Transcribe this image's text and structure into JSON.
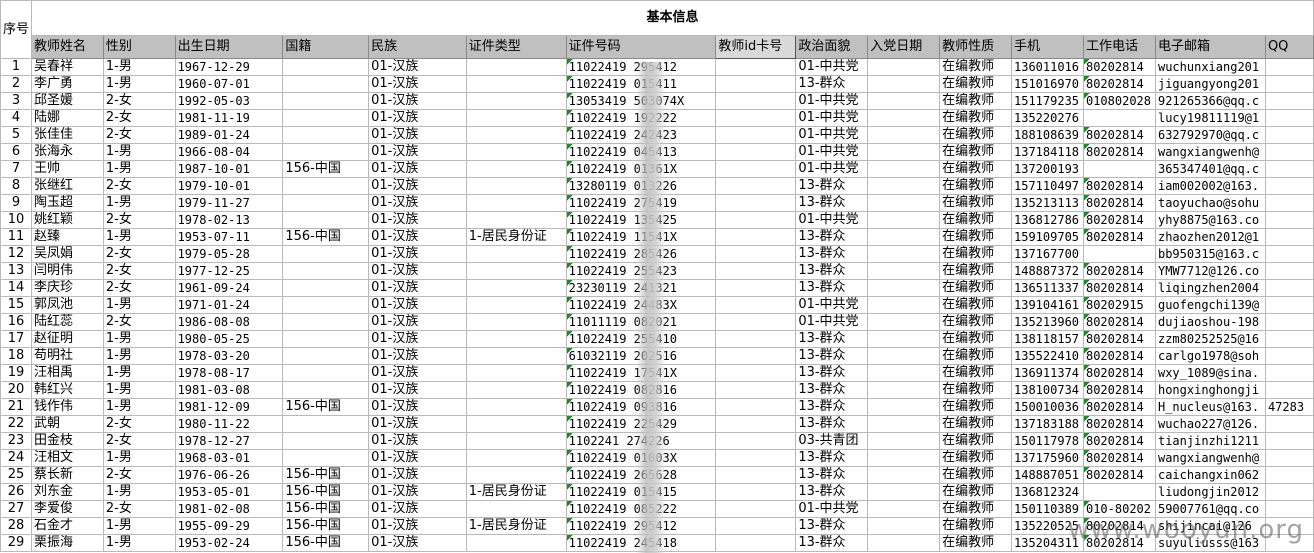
{
  "title": "基本信息",
  "seq_header": "序号",
  "columns": [
    "教师姓名",
    "性别",
    "出生日期",
    "国籍",
    "民族",
    "证件类型",
    "证件号码",
    "教师id卡号",
    "政治面貌",
    "入党日期",
    "教师性质",
    "手机",
    "工作电话",
    "电子邮箱",
    "QQ"
  ],
  "rows": [
    [
      "1",
      "吴春祥",
      "1-男",
      "1967-12-29",
      "",
      "01-汉族",
      "",
      "11022419    295412",
      "",
      "01-中共党",
      "",
      "在编教师",
      "136011016",
      "80202814",
      "wuchunxiang201",
      ""
    ],
    [
      "2",
      "李广勇",
      "1-男",
      "1960-07-01",
      "",
      "01-汉族",
      "",
      "11022419    015411",
      "",
      "13-群众",
      "",
      "在编教师",
      "151016970",
      "80202814",
      "jiguangyong201",
      ""
    ],
    [
      "3",
      "邱圣媛",
      "2-女",
      "1992-05-03",
      "",
      "01-汉族",
      "",
      "13053419    503074X",
      "",
      "01-中共党",
      "",
      "在编教师",
      "151179235",
      "010802028",
      "921265366@qq.c",
      ""
    ],
    [
      "4",
      "陆娜",
      "2-女",
      "1981-11-19",
      "",
      "01-汉族",
      "",
      "11022419    192222",
      "",
      "01-中共党",
      "",
      "在编教师",
      "135220276",
      "",
      "lucy19811119@1",
      ""
    ],
    [
      "5",
      "张佳佳",
      "2-女",
      "1989-01-24",
      "",
      "01-汉族",
      "",
      "11022419    242423",
      "",
      "01-中共党",
      "",
      "在编教师",
      "188108639",
      "80202814",
      "632792970@qq.c",
      ""
    ],
    [
      "6",
      "张海永",
      "1-男",
      "1966-08-04",
      "",
      "01-汉族",
      "",
      "11022419    045413",
      "",
      "01-中共党",
      "",
      "在编教师",
      "137184118",
      "80202814",
      "wangxiangwenh@",
      ""
    ],
    [
      "7",
      "王帅",
      "1-男",
      "1987-10-01",
      "156-中国",
      "01-汉族",
      "",
      "11022419    01361X",
      "",
      "01-中共党",
      "",
      "在编教师",
      "137200193",
      "",
      "365347401@qq.c",
      ""
    ],
    [
      "8",
      "张继红",
      "2-女",
      "1979-10-01",
      "",
      "01-汉族",
      "",
      "13280119    013226",
      "",
      "13-群众",
      "",
      "在编教师",
      "157110497",
      "80202814",
      "iam002002@163.",
      ""
    ],
    [
      "9",
      "陶玉超",
      "1-男",
      "1979-11-27",
      "",
      "01-汉族",
      "",
      "11022419    275419",
      "",
      "13-群众",
      "",
      "在编教师",
      "135213113",
      "80202814",
      "taoyuchao@sohu",
      ""
    ],
    [
      "10",
      "姚红颖",
      "2-女",
      "1978-02-13",
      "",
      "01-汉族",
      "",
      "11022419    135425",
      "",
      "01-中共党",
      "",
      "在编教师",
      "136812786",
      "80202814",
      "yhy8875@163.co",
      ""
    ],
    [
      "11",
      "赵臻",
      "1-男",
      "1953-07-11",
      "156-中国",
      "01-汉族",
      "1-居民身份证",
      "11022419    11541X",
      "",
      "13-群众",
      "",
      "在编教师",
      "159109705",
      "80202814",
      "zhaozhen2012@1",
      ""
    ],
    [
      "12",
      "吴凤娟",
      "2-女",
      "1979-05-28",
      "",
      "01-汉族",
      "",
      "11022419    285426",
      "",
      "13-群众",
      "",
      "在编教师",
      "137167700",
      "",
      "bb950315@163.c",
      ""
    ],
    [
      "13",
      "闫明伟",
      "2-女",
      "1977-12-25",
      "",
      "01-汉族",
      "",
      "11022419    255423",
      "",
      "13-群众",
      "",
      "在编教师",
      "148887372",
      "80202814",
      "YMW7712@126.co",
      ""
    ],
    [
      "14",
      "李庆珍",
      "2-女",
      "1961-09-24",
      "",
      "01-汉族",
      "",
      "23230119    241321",
      "",
      "13-群众",
      "",
      "在编教师",
      "136511337",
      "80202814",
      "liqingzhen2004",
      ""
    ],
    [
      "15",
      "郭凤池",
      "1-男",
      "1971-01-24",
      "",
      "01-汉族",
      "",
      "11022419    24483X",
      "",
      "01-中共党",
      "",
      "在编教师",
      "139104161",
      "80202915",
      "guofengchi139@",
      ""
    ],
    [
      "16",
      "陆红蕊",
      "2-女",
      "1986-08-08",
      "",
      "01-汉族",
      "",
      "11011119    082021",
      "",
      "01-中共党",
      "",
      "在编教师",
      "135213960",
      "80202814",
      "dujiaoshou-198",
      ""
    ],
    [
      "17",
      "赵征明",
      "1-男",
      "1980-05-25",
      "",
      "01-汉族",
      "",
      "11022419    255410",
      "",
      "13-群众",
      "",
      "在编教师",
      "138118157",
      "80202814",
      "zzm80252525@16",
      ""
    ],
    [
      "18",
      "苟明社",
      "1-男",
      "1978-03-20",
      "",
      "01-汉族",
      "",
      "61032119    202516",
      "",
      "13-群众",
      "",
      "在编教师",
      "135522410",
      "80202814",
      "carlgo1978@soh",
      ""
    ],
    [
      "19",
      "汪相禹",
      "1-男",
      "1978-08-17",
      "",
      "01-汉族",
      "",
      "11022419    17541X",
      "",
      "13-群众",
      "",
      "在编教师",
      "136911374",
      "80202814",
      "wxy_1089@sina.",
      ""
    ],
    [
      "20",
      "韩红兴",
      "1-男",
      "1981-03-08",
      "",
      "01-汉族",
      "",
      "11022419    082816",
      "",
      "13-群众",
      "",
      "在编教师",
      "138100734",
      "80202814",
      "hongxinghongji",
      ""
    ],
    [
      "21",
      "钱作伟",
      "1-男",
      "1981-12-09",
      "156-中国",
      "01-汉族",
      "",
      "11022419    093816",
      "",
      "13-群众",
      "",
      "在编教师",
      "150010036",
      "80202814",
      "H_nucleus@163.",
      "47283"
    ],
    [
      "22",
      "武朝",
      "2-女",
      "1980-11-22",
      "",
      "01-汉族",
      "",
      "11022419    225429",
      "",
      "13-群众",
      "",
      "在编教师",
      "137183188",
      "80202814",
      "wuchao227@126.",
      ""
    ],
    [
      "23",
      "田金枝",
      "2-女",
      "1978-12-27",
      "",
      "01-汉族",
      "",
      "1102241     274226",
      "",
      "03-共青团",
      "",
      "在编教师",
      "150117978",
      "80202814",
      "tianjinzhi1211",
      ""
    ],
    [
      "24",
      "汪相文",
      "1-男",
      "1968-03-01",
      "",
      "01-汉族",
      "",
      "11022419    01003X",
      "",
      "13-群众",
      "",
      "在编教师",
      "137175960",
      "80202814",
      "wangxiangwenh@",
      ""
    ],
    [
      "25",
      "蔡长新",
      "2-女",
      "1976-06-26",
      "156-中国",
      "01-汉族",
      "",
      "11022419    265628",
      "",
      "13-群众",
      "",
      "在编教师",
      "148887051",
      "80202814",
      "caichangxin062",
      ""
    ],
    [
      "26",
      "刘东金",
      "1-男",
      "1953-05-01",
      "156-中国",
      "01-汉族",
      "1-居民身份证",
      "11022419    015415",
      "",
      "13-群众",
      "",
      "在编教师",
      "136812324",
      "",
      "liudongjin2012",
      ""
    ],
    [
      "27",
      "李爱俊",
      "2-女",
      "1981-02-08",
      "156-中国",
      "01-汉族",
      "",
      "11022419    085222",
      "",
      "01-中共党",
      "",
      "在编教师",
      "150110389",
      "010-80202",
      "59007761@qq.co",
      ""
    ],
    [
      "28",
      "石金才",
      "1-男",
      "1955-09-29",
      "156-中国",
      "01-汉族",
      "1-居民身份证",
      "11022419    295412",
      "",
      "13-群众",
      "",
      "在编教师",
      "135220525",
      "80202814",
      "shijincai@126",
      ""
    ],
    [
      "29",
      "栗振海",
      "1-男",
      "1953-02-24",
      "156-中国",
      "01-汉族",
      "",
      "11022419    245418",
      "",
      "13-群众",
      "",
      "在编教师",
      "135204311",
      "80202814",
      "suyuliusss@163",
      ""
    ]
  ],
  "watermark": "www.wooyun.org",
  "colors": {
    "header_bg": "#c0c0c0",
    "grid": "#b9b9b9",
    "flag": "#1f8a2a"
  }
}
